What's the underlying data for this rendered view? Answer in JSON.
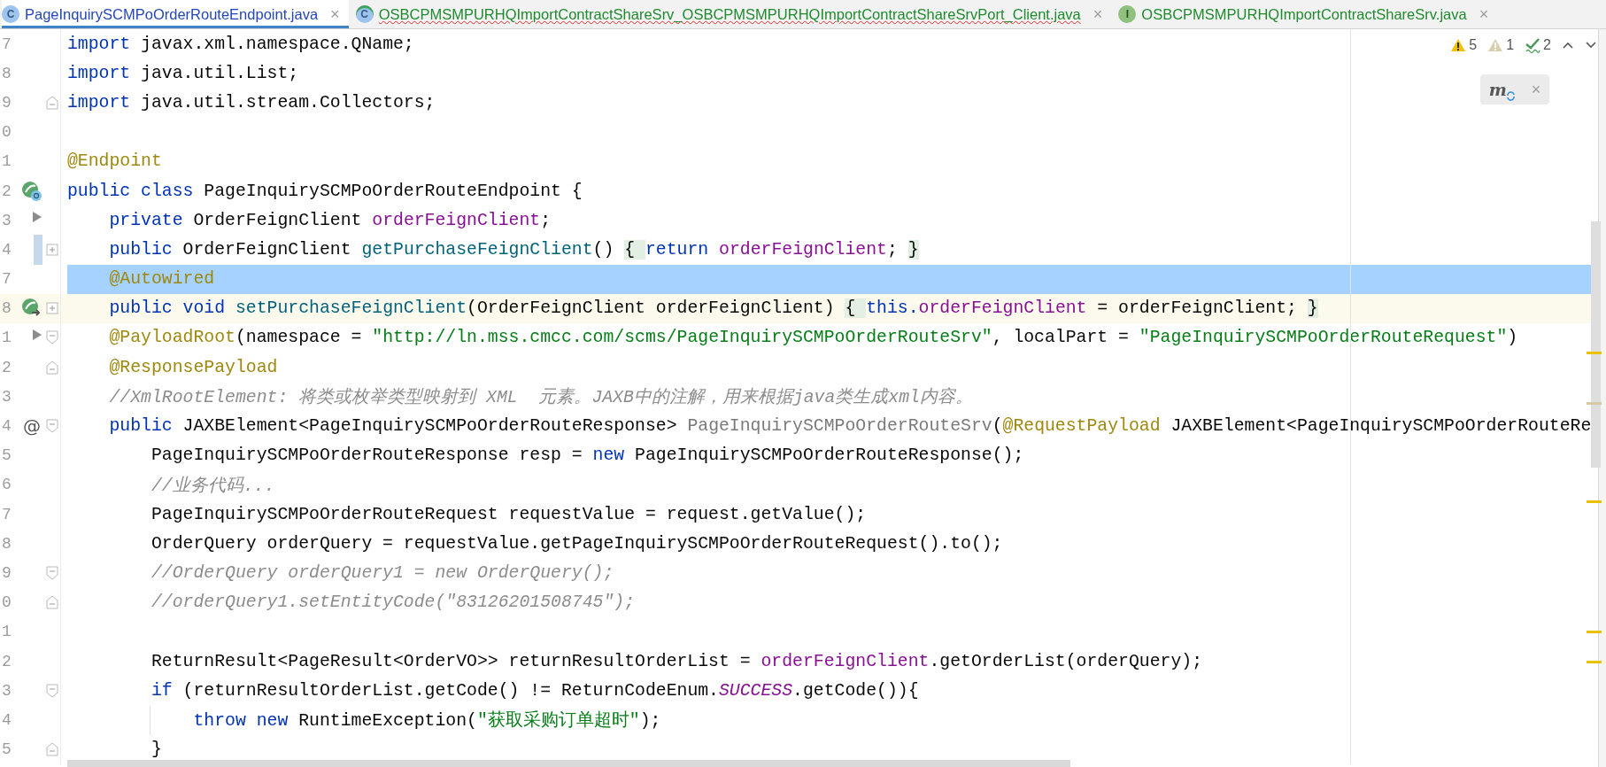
{
  "tabs": [
    {
      "label": "PageInquirySCMPoOrderRouteEndpoint.java",
      "kind": "class",
      "icon_letter": "C",
      "color": "#2446b8",
      "selected": true,
      "has_errors": false,
      "close": "×"
    },
    {
      "label": "OSBCPMSMPURHQImportContractShareSrv_OSBCPMSMPURHQImportContractShareSrvPort_Client.java",
      "kind": "class-service",
      "icon_letter": "C",
      "color": "#1f8a2e",
      "selected": false,
      "has_errors": true,
      "close": "×"
    },
    {
      "label": "OSBCPMSMPURHQImportContractShareSrv.java",
      "kind": "interface",
      "icon_letter": "I",
      "color": "#1f8a2e",
      "selected": false,
      "has_errors": false,
      "close": "×"
    }
  ],
  "inspections": [
    {
      "kind": "warning",
      "count": "5"
    },
    {
      "kind": "weak-warning",
      "count": "1"
    },
    {
      "kind": "typo",
      "count": "2"
    }
  ],
  "maven_popup": {
    "glyph": "m",
    "close": "×"
  },
  "lines": [
    {
      "number": "7",
      "selected": false,
      "current": false,
      "modified": false,
      "segments": [
        {
          "kind": "keyword",
          "text": "import"
        },
        {
          "kind": "plain",
          "text": " javax.xml.namespace.QName;"
        }
      ]
    },
    {
      "number": "8",
      "selected": false,
      "current": false,
      "modified": false,
      "segments": [
        {
          "kind": "keyword",
          "text": "import"
        },
        {
          "kind": "plain",
          "text": " java.util.List;"
        }
      ]
    },
    {
      "number": "9",
      "selected": false,
      "current": false,
      "modified": false,
      "fold": {
        "kind": "end"
      },
      "segments": [
        {
          "kind": "keyword",
          "text": "import"
        },
        {
          "kind": "plain",
          "text": " java.util.stream.Collectors;"
        }
      ]
    },
    {
      "number": "0",
      "selected": false,
      "current": false,
      "modified": false
    },
    {
      "number": "1",
      "selected": false,
      "current": false,
      "modified": false,
      "segments": [
        {
          "kind": "annotation",
          "text": "@Endpoint"
        }
      ]
    },
    {
      "number": "2",
      "selected": false,
      "current": false,
      "modified": false,
      "gutter_icon": {
        "kind": "bean-class"
      },
      "segments": [
        {
          "kind": "keyword",
          "text": "public class"
        },
        {
          "kind": "plain",
          "text": " PageInquirySCMPoOrderRouteEndpoint {"
        }
      ]
    },
    {
      "number": "3",
      "selected": false,
      "current": false,
      "modified": false,
      "gutter_icon": {
        "kind": "arrow"
      },
      "segments": [
        {
          "kind": "keyword",
          "text": "    private"
        },
        {
          "kind": "plain",
          "text": " OrderFeignClient "
        },
        {
          "kind": "field",
          "text": "orderFeignClient"
        },
        {
          "kind": "plain",
          "text": ";"
        }
      ]
    },
    {
      "number": "4",
      "selected": false,
      "current": false,
      "modified": true,
      "fold": {
        "kind": "collapsed"
      },
      "segments": [
        {
          "kind": "keyword",
          "text": "    public"
        },
        {
          "kind": "plain",
          "text": " OrderFeignClient "
        },
        {
          "kind": "method",
          "text": "getPurchaseFeignClient"
        },
        {
          "kind": "plain",
          "text": "() "
        },
        {
          "kind": "folded",
          "text": "{ "
        },
        {
          "kind": "keyword",
          "text": "return "
        },
        {
          "kind": "field",
          "text": "orderFeignClient"
        },
        {
          "kind": "plain",
          "text": "; "
        },
        {
          "kind": "folded",
          "text": "}"
        }
      ]
    },
    {
      "number": "7",
      "selected": true,
      "current": false,
      "modified": false,
      "segments": [
        {
          "kind": "annotation",
          "text": "    @Autowired"
        }
      ]
    },
    {
      "number": "8",
      "selected": false,
      "current": true,
      "modified": false,
      "gutter_icon": {
        "kind": "bean-inject"
      },
      "fold": {
        "kind": "collapsed"
      },
      "segments": [
        {
          "kind": "keyword",
          "text": "    public void "
        },
        {
          "kind": "method",
          "text": "setPurchaseFeignClient"
        },
        {
          "kind": "plain",
          "text": "(OrderFeignClient orderFeignClient) "
        },
        {
          "kind": "folded",
          "text": "{ "
        },
        {
          "kind": "keyword",
          "text": "this."
        },
        {
          "kind": "field",
          "text": "orderFeignClient"
        },
        {
          "kind": "plain",
          "text": " = orderFeignClient; "
        },
        {
          "kind": "folded",
          "text": "}"
        }
      ]
    },
    {
      "number": "1",
      "selected": false,
      "current": false,
      "modified": false,
      "gutter_icon": {
        "kind": "arrow"
      },
      "fold": {
        "kind": "start"
      },
      "segments": [
        {
          "kind": "annotation",
          "text": "    @PayloadRoot"
        },
        {
          "kind": "plain",
          "text": "(namespace = "
        },
        {
          "kind": "string",
          "text": "\"http://ln.mss.cmcc.com/scms/PageInquirySCMPoOrderRouteSrv\""
        },
        {
          "kind": "plain",
          "text": ", localPart = "
        },
        {
          "kind": "string",
          "text": "\"PageInquirySCMPoOrderRouteRequest\""
        },
        {
          "kind": "plain",
          "text": ")"
        }
      ]
    },
    {
      "number": "2",
      "selected": false,
      "current": false,
      "modified": false,
      "fold": {
        "kind": "end"
      },
      "segments": [
        {
          "kind": "annotation",
          "text": "    @ResponsePayload"
        }
      ]
    },
    {
      "number": "3",
      "selected": false,
      "current": false,
      "modified": false,
      "segments": [
        {
          "kind": "comment",
          "text": "    //XmlRootElement: 将类或枚举类型映射到 XML  元素。JAXB中的注解，用来根据java类生成xml内容。"
        }
      ]
    },
    {
      "number": "4",
      "selected": false,
      "current": false,
      "modified": false,
      "gutter_mark": "@",
      "fold": {
        "kind": "start"
      },
      "segments": [
        {
          "kind": "keyword",
          "text": "    public"
        },
        {
          "kind": "plain",
          "text": " JAXBElement<PageInquirySCMPoOrderRouteResponse> "
        },
        {
          "kind": "unused",
          "text": "PageInquirySCMPoOrderRouteSrv"
        },
        {
          "kind": "plain",
          "text": "("
        },
        {
          "kind": "annotation",
          "text": "@RequestPayload"
        },
        {
          "kind": "plain",
          "text": " JAXBElement<PageInquirySCMPoOrderRouteRe"
        }
      ]
    },
    {
      "number": "5",
      "selected": false,
      "current": false,
      "modified": false,
      "segments": [
        {
          "kind": "plain",
          "text": "        PageInquirySCMPoOrderRouteResponse resp = "
        },
        {
          "kind": "keyword",
          "text": "new"
        },
        {
          "kind": "plain",
          "text": " PageInquirySCMPoOrderRouteResponse();"
        }
      ]
    },
    {
      "number": "6",
      "selected": false,
      "current": false,
      "modified": false,
      "segments": [
        {
          "kind": "comment",
          "text": "        //业务代码..."
        }
      ]
    },
    {
      "number": "7",
      "selected": false,
      "current": false,
      "modified": false,
      "segments": [
        {
          "kind": "plain",
          "text": "        PageInquirySCMPoOrderRouteRequest requestValue = request.getValue();"
        }
      ]
    },
    {
      "number": "8",
      "selected": false,
      "current": false,
      "modified": false,
      "segments": [
        {
          "kind": "plain",
          "text": "        OrderQuery orderQuery = requestValue.getPageInquirySCMPoOrderRouteRequest().to();"
        }
      ]
    },
    {
      "number": "9",
      "selected": false,
      "current": false,
      "modified": false,
      "fold": {
        "kind": "start"
      },
      "segments": [
        {
          "kind": "comment",
          "text": "        //OrderQuery orderQuery1 = new OrderQuery();"
        }
      ]
    },
    {
      "number": "0",
      "selected": false,
      "current": false,
      "modified": false,
      "fold": {
        "kind": "end"
      },
      "segments": [
        {
          "kind": "comment",
          "text": "        //orderQuery1.setEntityCode(\"83126201508745\");"
        }
      ]
    },
    {
      "number": "1",
      "selected": false,
      "current": false,
      "modified": false
    },
    {
      "number": "2",
      "selected": false,
      "current": false,
      "modified": false,
      "segments": [
        {
          "kind": "plain",
          "text": "        ReturnResult<PageResult<OrderVO>> returnResultOrderList = "
        },
        {
          "kind": "field",
          "text": "orderFeignClient"
        },
        {
          "kind": "plain",
          "text": ".getOrderList(orderQuery);"
        }
      ]
    },
    {
      "number": "3",
      "selected": false,
      "current": false,
      "modified": false,
      "fold": {
        "kind": "start"
      },
      "segments": [
        {
          "kind": "keyword",
          "text": "        if"
        },
        {
          "kind": "plain",
          "text": " (returnResultOrderList.getCode() != ReturnCodeEnum."
        },
        {
          "kind": "static",
          "text": "SUCCESS"
        },
        {
          "kind": "plain",
          "text": ".getCode()){"
        }
      ]
    },
    {
      "number": "4",
      "selected": false,
      "current": false,
      "modified": false,
      "segments": [
        {
          "kind": "keyword",
          "text": "            throw new"
        },
        {
          "kind": "plain",
          "text": " RuntimeException("
        },
        {
          "kind": "string",
          "text": "\"获取采购订单超时\""
        },
        {
          "kind": "plain",
          "text": ");"
        }
      ]
    },
    {
      "number": "5",
      "selected": false,
      "current": false,
      "modified": false,
      "fold": {
        "kind": "end"
      },
      "segments": [
        {
          "kind": "plain",
          "text": "        }"
        }
      ]
    }
  ]
}
